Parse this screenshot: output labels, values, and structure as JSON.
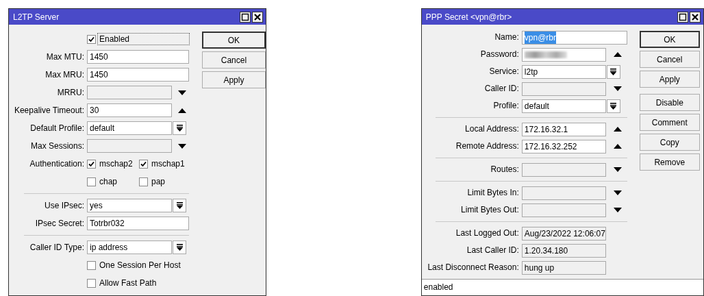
{
  "windows": [
    {
      "title": "L2TP Server",
      "rows": [
        {
          "kind": "checkbox",
          "label": "Enabled",
          "checked": true,
          "focused": true
        },
        {
          "kind": "field",
          "label": "Max MTU:",
          "value": "1450"
        },
        {
          "kind": "field",
          "label": "Max MRU:",
          "value": "1450"
        },
        {
          "kind": "field",
          "label": "MRRU:",
          "control": {
            "kind": "down"
          }
        },
        {
          "kind": "field",
          "label": "Keepalive Timeout:",
          "value": "30",
          "control": {
            "kind": "up"
          }
        },
        {
          "kind": "field",
          "label": "Default Profile:",
          "value": "default",
          "control": {
            "kind": "select"
          }
        },
        {
          "kind": "field",
          "label": "Max Sessions:",
          "control": {
            "kind": "down"
          }
        },
        {
          "kind": "checks",
          "label": "Authentication:",
          "items": [
            {
              "label": "mschap2",
              "checked": true
            },
            {
              "label": "mschap1",
              "checked": true
            },
            {
              "label": "chap",
              "checked": false
            },
            {
              "label": "pap",
              "checked": false
            }
          ]
        },
        {
          "kind": "separator"
        },
        {
          "kind": "field",
          "label": "Use IPsec:",
          "value": "yes",
          "control": {
            "kind": "select"
          }
        },
        {
          "kind": "field",
          "label": "IPsec Secret:",
          "value": "Totrbr032"
        },
        {
          "kind": "separator"
        },
        {
          "kind": "field",
          "label": "Caller ID Type:",
          "value": "ip address",
          "control": {
            "kind": "select"
          }
        },
        {
          "kind": "checkbox",
          "label": "One Session Per Host",
          "checked": false,
          "focused": false
        },
        {
          "kind": "checkbox",
          "label": "Allow Fast Path",
          "checked": false,
          "focused": false
        }
      ],
      "button_groups": [
        [
          {
            "label": "OK",
            "default": true
          },
          {
            "label": "Cancel",
            "default": false
          },
          {
            "label": "Apply",
            "default": false
          }
        ]
      ]
    },
    {
      "title": "PPP Secret <vpn@rbr>",
      "rows": [
        {
          "kind": "field",
          "label": "Name:",
          "value": "vpn@rbr",
          "selected": true
        },
        {
          "kind": "field",
          "label": "Password:",
          "masked": true,
          "control": {
            "kind": "up"
          }
        },
        {
          "kind": "field",
          "label": "Service:",
          "value": "l2tp",
          "control": {
            "kind": "select"
          }
        },
        {
          "kind": "field",
          "label": "Caller ID:",
          "control": {
            "kind": "down"
          }
        },
        {
          "kind": "field",
          "label": "Profile:",
          "value": "default",
          "control": {
            "kind": "select"
          }
        },
        {
          "kind": "separator"
        },
        {
          "kind": "field",
          "label": "Local Address:",
          "value": "172.16.32.1",
          "control": {
            "kind": "up"
          }
        },
        {
          "kind": "field",
          "label": "Remote Address:",
          "value": "172.16.32.252",
          "control": {
            "kind": "up"
          }
        },
        {
          "kind": "separator"
        },
        {
          "kind": "field",
          "label": "Routes:",
          "control": {
            "kind": "down"
          }
        },
        {
          "kind": "separator"
        },
        {
          "kind": "field",
          "label": "Limit Bytes In:",
          "control": {
            "kind": "down"
          }
        },
        {
          "kind": "field",
          "label": "Limit Bytes Out:",
          "control": {
            "kind": "down"
          }
        },
        {
          "kind": "separator"
        },
        {
          "kind": "field",
          "label": "Last Logged Out:",
          "value": "Aug/23/2022 12:06:07",
          "readonly": true
        },
        {
          "kind": "field",
          "label": "Last Caller ID:",
          "value": "1.20.34.180",
          "readonly": true
        },
        {
          "kind": "field",
          "label": "Last Disconnect Reason:",
          "value": "hung up",
          "readonly": true
        }
      ],
      "button_groups": [
        [
          {
            "label": "OK",
            "default": true
          },
          {
            "label": "Cancel",
            "default": false
          },
          {
            "label": "Apply",
            "default": false
          }
        ],
        [
          {
            "label": "Disable",
            "default": false
          },
          {
            "label": "Comment",
            "default": false
          },
          {
            "label": "Copy",
            "default": false
          },
          {
            "label": "Remove",
            "default": false
          }
        ]
      ],
      "status_bar": "enabled"
    }
  ]
}
